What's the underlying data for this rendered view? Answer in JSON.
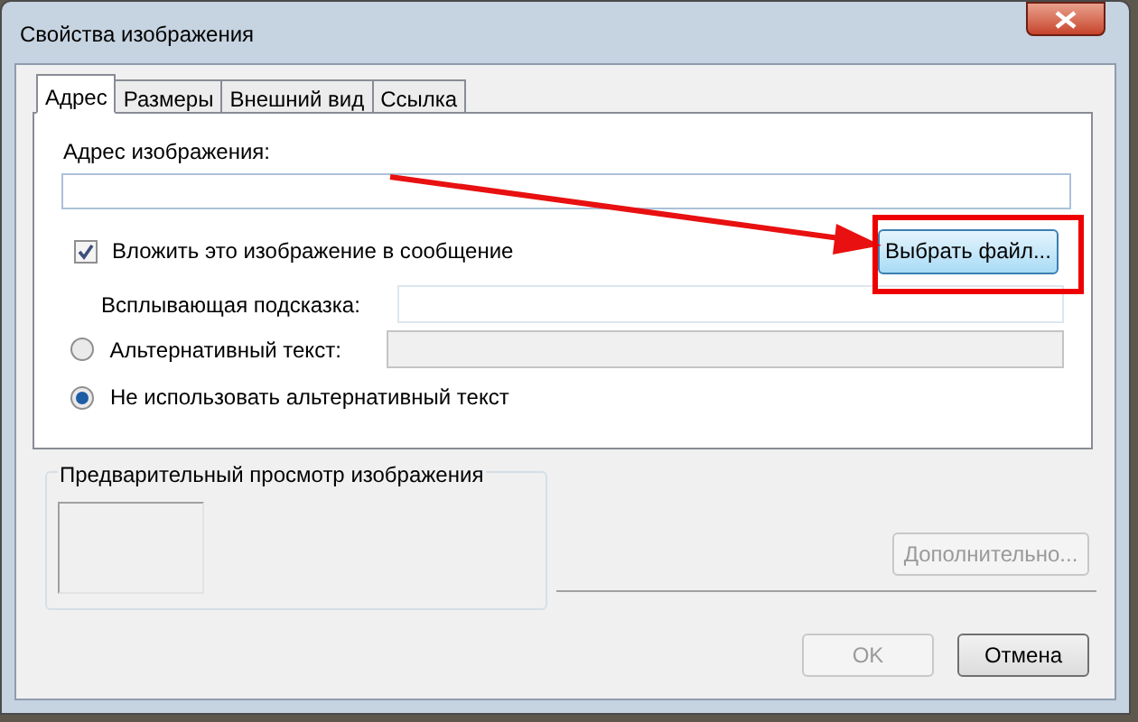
{
  "window": {
    "title": "Свойства изображения"
  },
  "tabs": [
    {
      "label": "Адрес",
      "selected": true
    },
    {
      "label": "Размеры",
      "selected": false
    },
    {
      "label": "Внешний вид",
      "selected": false
    },
    {
      "label": "Ссылка",
      "selected": false
    }
  ],
  "address": {
    "label": "Адрес изображения:"
  },
  "embed": {
    "label": "Вложить это изображение в сообщение",
    "checked": true
  },
  "choose_file_button": {
    "label": "Выбрать файл..."
  },
  "tooltip": {
    "label": "Всплывающая подсказка:"
  },
  "alt_options": [
    {
      "label": "Альтернативный текст:",
      "selected": false,
      "field_disabled": true
    },
    {
      "label": "Не использовать альтернативный текст",
      "selected": true
    }
  ],
  "preview": {
    "title": "Предварительный просмотр изображения"
  },
  "advanced_button": {
    "label": "Дополнительно...",
    "disabled": true
  },
  "buttons": [
    {
      "label": "OK",
      "disabled": true
    },
    {
      "label": "Отмена",
      "disabled": false
    }
  ]
}
